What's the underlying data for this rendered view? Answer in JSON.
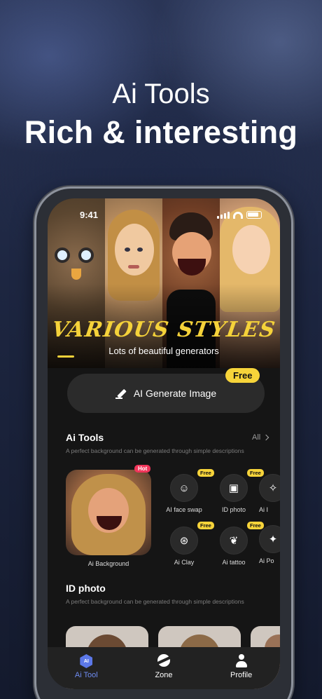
{
  "hero": {
    "line1": "Ai Tools",
    "line2": "Rich & interesting"
  },
  "status": {
    "time": "9:41"
  },
  "banner": {
    "title": "VARIOUS STYLES",
    "subtitle": "Lots of beautiful generators"
  },
  "generate": {
    "label": "AI Generate Image",
    "badge": "Free"
  },
  "ai_tools": {
    "title": "Ai Tools",
    "all": "All",
    "description": "A perfect background can be generated through simple descriptions",
    "featured": {
      "label": "Ai Background",
      "badge": "Hot"
    },
    "items": [
      {
        "label": "AI face swap",
        "badge": "Free",
        "icon": "face-swap-icon"
      },
      {
        "label": "ID photo",
        "badge": "Free",
        "icon": "id-photo-icon"
      },
      {
        "label": "Ai I",
        "badge": "",
        "icon": "ai-tool-icon"
      },
      {
        "label": "Ai Clay",
        "badge": "Free",
        "icon": "clay-icon"
      },
      {
        "label": "Ai tattoo",
        "badge": "Free",
        "icon": "tattoo-icon"
      },
      {
        "label": "Ai Po",
        "badge": "",
        "icon": "ai-tool-icon"
      }
    ]
  },
  "id_photo": {
    "title": "ID photo",
    "description": "A perfect background can be generated through simple descriptions"
  },
  "tabbar": {
    "tabs": [
      {
        "label": "Ai Tool",
        "icon": "ai-tool-tab-icon",
        "active": true
      },
      {
        "label": "Zone",
        "icon": "planet-icon",
        "active": false
      },
      {
        "label": "Profile",
        "icon": "person-icon",
        "active": false
      }
    ]
  },
  "colors": {
    "accent": "#f7d43a",
    "hot": "#f0355a",
    "active_tab": "#6f8cf1"
  }
}
